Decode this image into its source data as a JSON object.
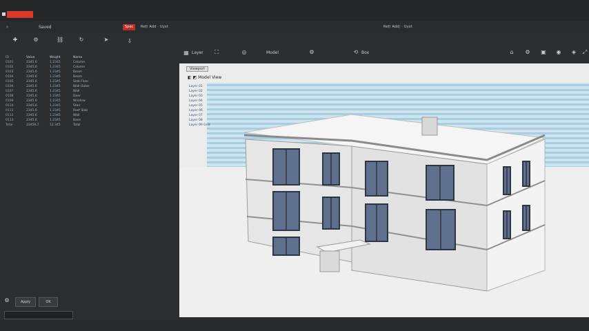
{
  "titlebar": {
    "tab_close_label": "× ·",
    "tab_name": "Saved",
    "badge_label": "Spec",
    "center_path": "Ref/ Add ·  Uyst",
    "right_path": "Ref/ Add/ ·  Uyst"
  },
  "viewport_toolbar": {
    "layer_label": "Layer",
    "view_mode_label": "Model",
    "zoom_label": "Box"
  },
  "data_table": {
    "headers": [
      "ID",
      "Value",
      "Weight",
      "Name"
    ],
    "rows": [
      [
        "0101",
        "2345.6",
        "1.2345",
        "Column"
      ],
      [
        "0102",
        "2345.6",
        "1.2345",
        "Column"
      ],
      [
        "0103",
        "2345.6",
        "1.2345",
        "Beam"
      ],
      [
        "0104",
        "2345.6",
        "1.2345",
        "Beam"
      ],
      [
        "0105",
        "2345.6",
        "1.2345",
        "Slab Floor"
      ],
      [
        "0106",
        "2345.6",
        "1.2345",
        "Wall Outer"
      ],
      [
        "0107",
        "2345.6",
        "1.2345",
        "Wall"
      ],
      [
        "0108",
        "2345.6",
        "1.2345",
        "Door"
      ],
      [
        "0109",
        "2345.6",
        "1.2345",
        "Window"
      ],
      [
        "0110",
        "2345.6",
        "1.2345",
        "Stair"
      ],
      [
        "0111",
        "2345.6",
        "1.2345",
        "Roof Slab"
      ],
      [
        "0112",
        "2345.6",
        "1.2345",
        "Wall"
      ],
      [
        "0113",
        "2345.6",
        "1.2345",
        "Base"
      ],
      [
        "Total",
        "23456.7",
        "12.345",
        "Total"
      ]
    ]
  },
  "left_bottom": {
    "apply_label": "Apply",
    "ok_label": "OK",
    "input_value": ""
  },
  "viewport": {
    "tab_label": "Viewport",
    "model_label": "Model View",
    "layer_list": [
      "Layer 01",
      "Layer 02",
      "Layer 03",
      "Layer 04",
      "Layer 05",
      "Layer 06",
      "Layer 07",
      "Layer 08",
      "Layer 09 Grid"
    ]
  },
  "colors": {
    "accent": "#d8392b",
    "background": "#2d2e30",
    "viewport_bg": "#ececec",
    "sky_stripes": "#a6d0e2"
  },
  "icons": {
    "toolbar_left": [
      "plus-icon",
      "gear-icon",
      "link-icon",
      "rotate-icon",
      "arrow-icon",
      "pin-icon"
    ],
    "toolbar_right": [
      "home-icon",
      "gear-icon",
      "window-icon",
      "camera-icon",
      "cube-icon",
      "expand-icon"
    ]
  }
}
